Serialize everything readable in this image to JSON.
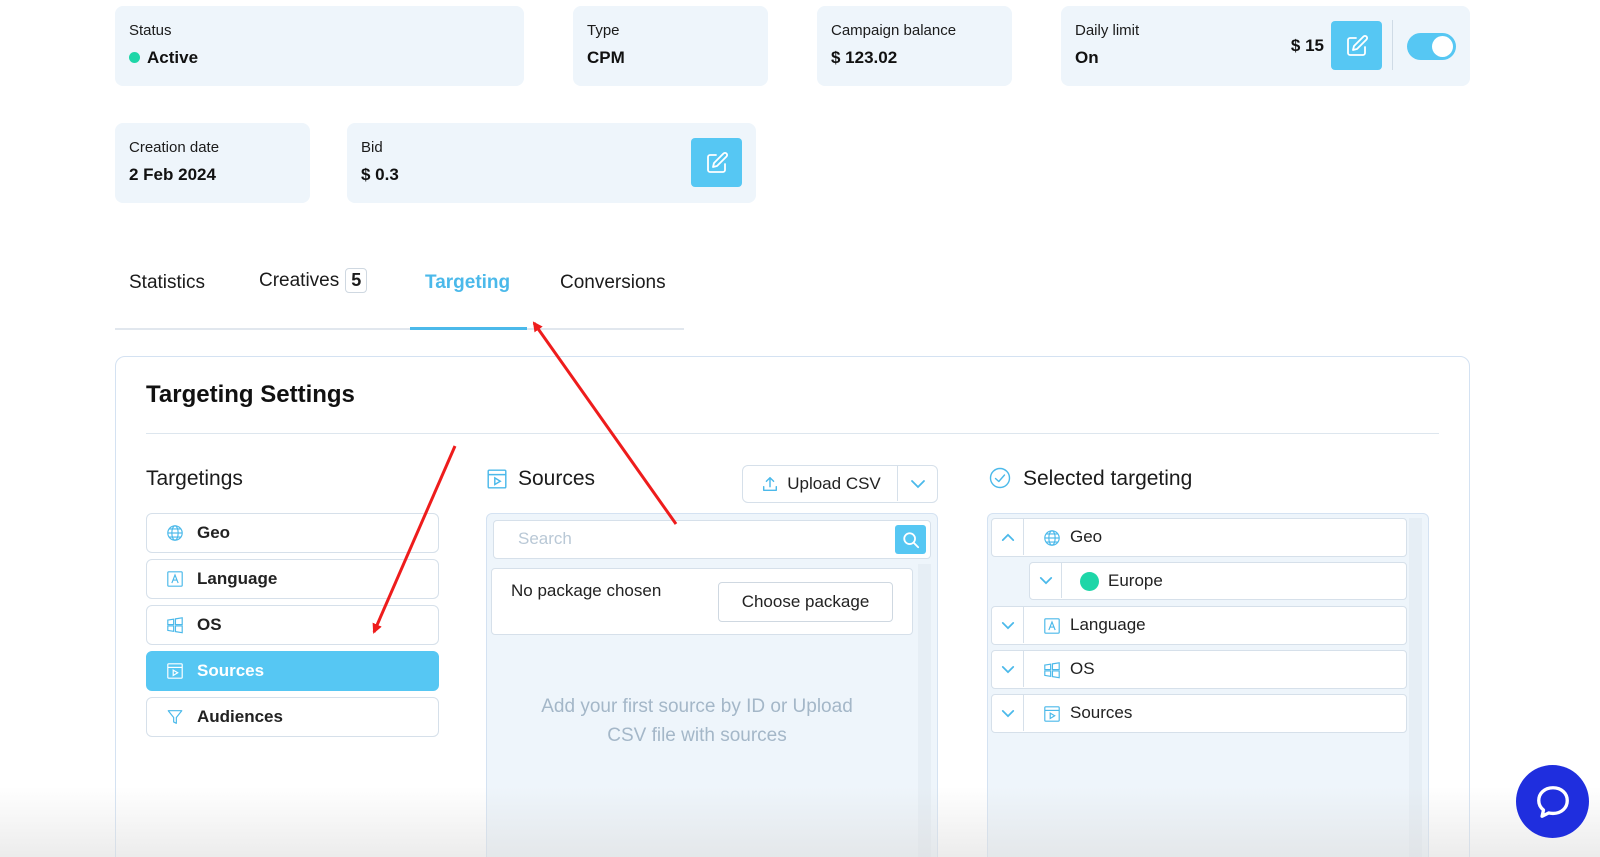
{
  "summary": {
    "status": {
      "label": "Status",
      "value": "Active",
      "color": "#1ed6a8"
    },
    "type": {
      "label": "Type",
      "value": "CPM"
    },
    "balance": {
      "label": "Campaign balance",
      "value": "$ 123.02"
    },
    "daily_limit": {
      "label": "Daily limit",
      "value": "On",
      "amount": "$ 15",
      "enabled": true
    },
    "creation_date": {
      "label": "Creation date",
      "value": "2 Feb 2024"
    },
    "bid": {
      "label": "Bid",
      "value": "$ 0.3"
    }
  },
  "tabs": [
    {
      "label": "Statistics"
    },
    {
      "label": "Creatives",
      "count": "5"
    },
    {
      "label": "Targeting",
      "active": true
    },
    {
      "label": "Conversions"
    }
  ],
  "panel": {
    "title": "Targeting Settings",
    "targetings": {
      "title": "Targetings",
      "items": [
        {
          "label": "Geo",
          "icon": "globe-icon"
        },
        {
          "label": "Language",
          "icon": "language-icon"
        },
        {
          "label": "OS",
          "icon": "windows-icon"
        },
        {
          "label": "Sources",
          "icon": "sources-icon",
          "active": true
        },
        {
          "label": "Audiences",
          "icon": "filter-icon"
        }
      ]
    },
    "sources": {
      "title": "Sources",
      "upload_label": "Upload CSV",
      "search_placeholder": "Search",
      "package_text": "No package chosen",
      "choose_package_label": "Choose package",
      "empty_message": "Add your first source by ID or Upload CSV file with sources"
    },
    "selected": {
      "title": "Selected targeting",
      "rows": [
        {
          "label": "Geo",
          "expanded": true,
          "icon": "globe-icon"
        },
        {
          "label": "Europe",
          "nested": true
        },
        {
          "label": "Language",
          "icon": "language-icon"
        },
        {
          "label": "OS",
          "icon": "windows-icon"
        },
        {
          "label": "Sources",
          "icon": "sources-icon"
        }
      ]
    }
  },
  "colors": {
    "accent": "#56c7f3",
    "card_bg": "#eef5fb",
    "annotation_arrow": "#ee1c1c",
    "chat_button": "#1f2ede"
  }
}
